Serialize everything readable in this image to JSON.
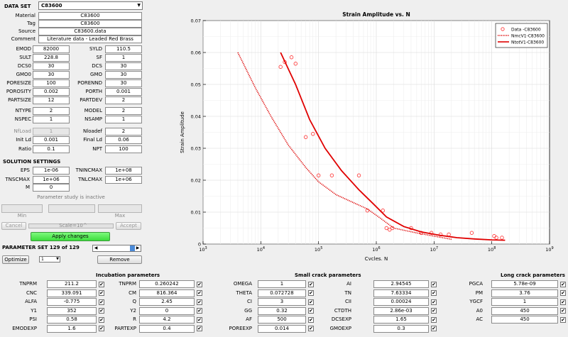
{
  "data_set": {
    "label": "DATA SET",
    "selected": "C83600"
  },
  "info": [
    {
      "label": "Material",
      "value": "C83600"
    },
    {
      "label": "Tag",
      "value": "C83600"
    },
    {
      "label": "Source",
      "value": "C83600.data"
    },
    {
      "label": "Comment",
      "value": "Literature data - Leaded Red Brass"
    }
  ],
  "params_left": [
    {
      "label": "EMOD",
      "value": "82000"
    },
    {
      "label": "SULT",
      "value": "228.8"
    },
    {
      "label": "DCS0",
      "value": "30"
    },
    {
      "label": "GMO0",
      "value": "30"
    },
    {
      "label": "PORESIZE",
      "value": "100"
    },
    {
      "label": "POROSITY",
      "value": "0.002"
    },
    {
      "label": "PARTSIZE",
      "value": "12"
    },
    {
      "label": "NTYPE",
      "value": "2"
    },
    {
      "label": "NSPEC",
      "value": "1"
    },
    {
      "label": "NfLoad",
      "value": "1"
    },
    {
      "label": "Init Ld",
      "value": "0.001"
    },
    {
      "label": "Ratio",
      "value": "0.1"
    }
  ],
  "params_right": [
    {
      "label": "SYLD",
      "value": "110.5"
    },
    {
      "label": "SF",
      "value": "1"
    },
    {
      "label": "DCS",
      "value": "30"
    },
    {
      "label": "GMO",
      "value": "30"
    },
    {
      "label": "PORENND",
      "value": "30"
    },
    {
      "label": "PORTH",
      "value": "0.001"
    },
    {
      "label": "PARTDEV",
      "value": "2"
    },
    {
      "label": "MODEL",
      "value": "2"
    },
    {
      "label": "NSAMP",
      "value": "1"
    },
    {
      "label": "Nloadef",
      "value": "2"
    },
    {
      "label": "Final Ld",
      "value": "0.06"
    },
    {
      "label": "NPT",
      "value": "100"
    }
  ],
  "solution": {
    "title": "SOLUTION SETTINGS",
    "left": [
      {
        "label": "EPS",
        "value": "1e-06"
      },
      {
        "label": "TNSCMAX",
        "value": "1e+06"
      },
      {
        "label": "M",
        "value": "0"
      }
    ],
    "right": [
      {
        "label": "TNINCMAX",
        "value": "1e+08"
      },
      {
        "label": "TNLCMAX",
        "value": "1e+06"
      }
    ]
  },
  "study": {
    "inactive": "Parameter study is inactive",
    "min": "Min",
    "max": "Max",
    "cancel": "Cancel",
    "scale": "Scale=10^",
    "accept": "Accept"
  },
  "apply_label": "Apply changes",
  "paramset": {
    "label": "PARAMETER SET 129 of 129",
    "optimize": "Optimize",
    "select": "1",
    "remove": "Remove"
  },
  "chart_data": {
    "type": "scatter",
    "title": "Strain Amplitude vs. N",
    "xlabel": "Cycles, N",
    "ylabel": "Strain Amplitude",
    "xscale": "log",
    "xlim": [
      1000,
      1000000000
    ],
    "ylim": [
      0,
      0.07
    ],
    "grid": true,
    "legend_position": "top-right",
    "x_ticks": [
      "10^3",
      "10^4",
      "10^5",
      "10^6",
      "10^7",
      "10^8",
      "10^9"
    ],
    "y_ticks": [
      "0",
      "0.01",
      "0.02",
      "0.03",
      "0.04",
      "0.05",
      "0.06",
      "0.07"
    ],
    "series": [
      {
        "name": "Data -C83600",
        "style": "markers",
        "color": "#ff3030",
        "x": [
          22000,
          26000,
          34000,
          40000,
          60000,
          80000,
          100000,
          170000,
          500000,
          700000,
          1300000,
          1500000,
          1700000,
          1900000,
          4000000,
          6000000,
          9000000,
          13000000,
          18000000,
          45000000,
          110000000,
          120000000,
          150000000
        ],
        "y": [
          0.0555,
          0.057,
          0.0585,
          0.0565,
          0.0335,
          0.0345,
          0.0215,
          0.0215,
          0.0215,
          0.0105,
          0.0105,
          0.005,
          0.0045,
          0.005,
          0.005,
          0.0035,
          0.0035,
          0.003,
          0.003,
          0.0035,
          0.0025,
          0.002,
          0.002
        ]
      },
      {
        "name": "NmcV1-C83600",
        "style": "dotted",
        "color": "#dd0000",
        "x": [
          4000,
          8000,
          15000,
          30000,
          60000,
          100000,
          200000,
          400000,
          700000,
          1200000,
          2000000,
          5000000,
          10000000,
          20000000
        ],
        "y": [
          0.06,
          0.049,
          0.04,
          0.031,
          0.024,
          0.0195,
          0.0155,
          0.013,
          0.011,
          0.008,
          0.005,
          0.0035,
          0.0025,
          0.0015
        ]
      },
      {
        "name": "NtotV1-C83600",
        "style": "solid",
        "color": "#e00000",
        "x": [
          22000,
          40000,
          70000,
          130000,
          250000,
          500000,
          900000,
          1500000,
          3000000,
          6000000,
          12000000,
          25000000,
          50000000,
          100000000,
          170000000
        ],
        "y": [
          0.06,
          0.05,
          0.039,
          0.03,
          0.023,
          0.017,
          0.0125,
          0.0085,
          0.0055,
          0.0038,
          0.0028,
          0.002,
          0.0016,
          0.0013,
          0.0012
        ]
      }
    ]
  },
  "incubation": {
    "title": "Incubation parameters",
    "left": [
      {
        "label": "TNPRM",
        "value": "211.2",
        "checked": true
      },
      {
        "label": "CNC",
        "value": "339.091",
        "checked": true
      },
      {
        "label": "ALFA",
        "value": "-0.775",
        "checked": true
      },
      {
        "label": "Y1",
        "value": "352",
        "checked": true
      },
      {
        "label": "PSI",
        "value": "0.58",
        "checked": true
      },
      {
        "label": "EMODEXP",
        "value": "1.6",
        "checked": true
      }
    ],
    "right": [
      {
        "label": "TNPRM",
        "value": "0.260242",
        "checked": true
      },
      {
        "label": "CM",
        "value": "816.364",
        "checked": true
      },
      {
        "label": "Q",
        "value": "2.45",
        "checked": true
      },
      {
        "label": "Y2",
        "value": "0",
        "checked": true
      },
      {
        "label": "R",
        "value": "4.2",
        "checked": true
      },
      {
        "label": "PARTEXP",
        "value": "0.4",
        "checked": true
      }
    ]
  },
  "small_crack": {
    "title": "Small crack parameters",
    "left": [
      {
        "label": "OMEGA",
        "value": "1",
        "checked": true
      },
      {
        "label": "THETA",
        "value": "0.072728",
        "checked": true
      },
      {
        "label": "CI",
        "value": "3",
        "checked": true
      },
      {
        "label": "GG",
        "value": "0.32",
        "checked": true
      },
      {
        "label": "AF",
        "value": "500",
        "checked": true
      },
      {
        "label": "POREEXP",
        "value": "0.014",
        "checked": true
      }
    ],
    "right": [
      {
        "label": "AI",
        "value": "2.94545",
        "checked": true
      },
      {
        "label": "TN",
        "value": "7.63334",
        "checked": true
      },
      {
        "label": "CII",
        "value": "0.00024",
        "checked": true
      },
      {
        "label": "CTDTH",
        "value": "2.86e-03",
        "checked": true
      },
      {
        "label": "DCSEXP",
        "value": "1.65",
        "checked": true
      },
      {
        "label": "GMOEXP",
        "value": "0.3",
        "checked": true
      }
    ]
  },
  "long_crack": {
    "title": "Long crack parameters",
    "left": [
      {
        "label": "PGCA",
        "value": "5.78e-09",
        "checked": true
      },
      {
        "label": "PM",
        "value": "3.76",
        "checked": true
      },
      {
        "label": "YGCF",
        "value": "1",
        "checked": true
      },
      {
        "label": "A0",
        "value": "450",
        "checked": true
      },
      {
        "label": "AC",
        "value": "450",
        "checked": true
      }
    ]
  },
  "checkmark": "✔"
}
